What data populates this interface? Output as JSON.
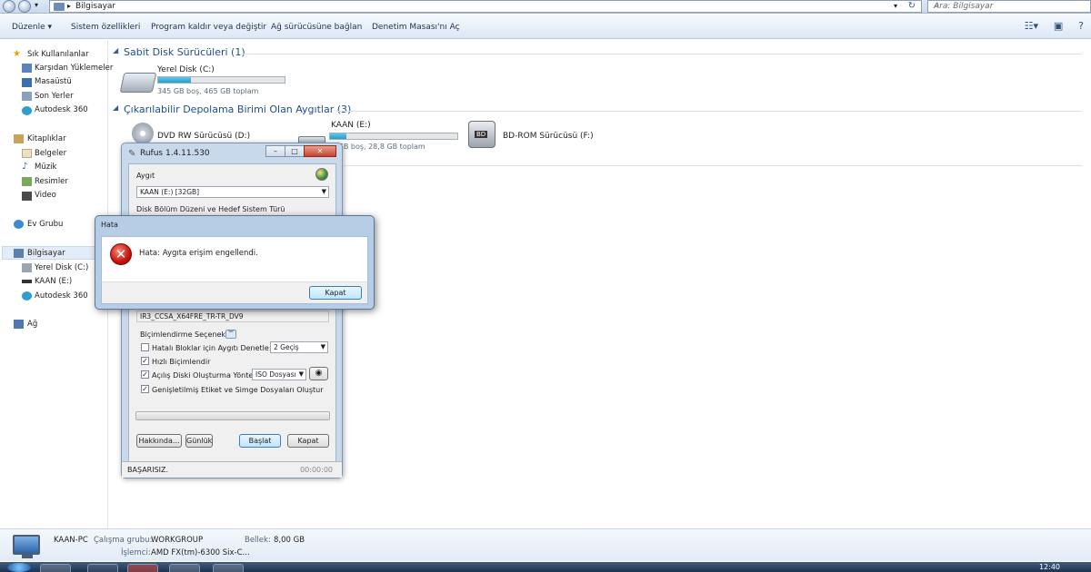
{
  "address_bar": {
    "location": "Bilgisayar",
    "search_placeholder": "Ara: Bilgisayar"
  },
  "toolbar": {
    "organize": "Düzenle",
    "system_properties": "Sistem özellikleri",
    "uninstall": "Program kaldır veya değiştir",
    "map_drive": "Ağ sürücüsüne bağlan",
    "control_panel": "Denetim Masası'nı Aç"
  },
  "nav": {
    "favorites": "Sık Kullanılanlar",
    "downloads": "Karşıdan Yüklemeler",
    "desktop": "Masaüstü",
    "recent": "Son Yerler",
    "autodesk_fav": "Autodesk 360",
    "libraries": "Kitaplıklar",
    "documents": "Belgeler",
    "music": "Müzik",
    "pictures": "Resimler",
    "video": "Video",
    "homegroup": "Ev Grubu",
    "computer": "Bilgisayar",
    "local_disk": "Yerel Disk (C:)",
    "kaan": "KAAN (E:)",
    "autodesk": "Autodesk 360",
    "network": "Ağ"
  },
  "content": {
    "hdd_section": "Sabit Disk Sürücüleri (1)",
    "removable_section": "Çıkarılabilir Depolama Birimi Olan Aygıtlar (3)",
    "drive_c": {
      "name": "Yerel Disk (C:)",
      "space": "345 GB boş, 465 GB toplam",
      "used_fraction": 0.26
    },
    "dvd": {
      "name": "DVD RW Sürücüsü (D:)"
    },
    "kaan_e": {
      "name": "KAAN (E:)",
      "space": "0 GB boş, 28,8 GB toplam",
      "used_fraction": 0.13
    },
    "bdrom": {
      "name": "BD-ROM Sürücüsü (F:)"
    }
  },
  "rufus": {
    "title": "Rufus 1.4.11.530",
    "device_label": "Aygıt",
    "device_value": "KAAN (E:) [32GB]",
    "partition_label": "Disk Bölüm Düzeni ve Hedef Sistem Türü",
    "volume_label_value": "IR3_CCSA_X64FRE_TR-TR_DV9",
    "format_options_label": "Biçimlendirme Seçenekleri",
    "bad_blocks": "Hatalı Bloklar için Aygıtı Denetle:",
    "passes": "2 Geçiş",
    "quick_format": "Hızlı Biçimlendir",
    "bootable": "Açılış Diski Oluşturma Yöntemi:",
    "iso_option": "ISO Dosyası",
    "extended_label": "Genişletilmiş Etiket ve Simge Dosyaları Oluştur",
    "about_button": "Hakkında...",
    "log_button": "Günlük",
    "start_button": "Başlat",
    "close_button": "Kapat",
    "status": "BAŞARISIZ.",
    "timer": "00:00:00"
  },
  "error_dialog": {
    "title": "Hata",
    "message": "Hata: Aygıta erişim engellendi.",
    "ok_button": "Kapat"
  },
  "details": {
    "pc_name": "KAAN-PC",
    "workgroup_label": "Çalışma grubu:",
    "workgroup": "WORKGROUP",
    "memory_label": "Bellek:",
    "memory": "8,00 GB",
    "cpu_label": "İşlemci:",
    "cpu": "AMD FX(tm)-6300 Six-C..."
  },
  "taskbar": {
    "clock": "12:40"
  }
}
